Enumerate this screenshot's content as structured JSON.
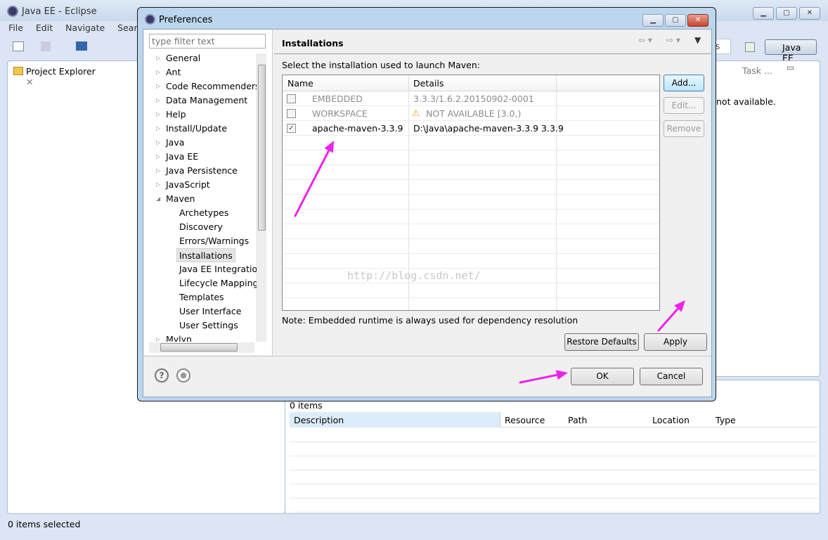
{
  "eclipse": {
    "title": "Java EE - Eclipse",
    "menu": [
      "File",
      "Edit",
      "Navigate",
      "Search"
    ],
    "perspective": "Java EE",
    "project_explorer_tab": "Project Explorer",
    "task_tab": "Task ...",
    "not_available": "not available.",
    "quick_access_partial": "s",
    "status": "0 items selected",
    "markers": {
      "count": "0 items",
      "columns": [
        "Description",
        "Resource",
        "Path",
        "Location",
        "Type"
      ]
    }
  },
  "dialog": {
    "title": "Preferences",
    "filter_placeholder": "type filter text",
    "tree": [
      {
        "label": "General",
        "level": 0,
        "expanded": false
      },
      {
        "label": "Ant",
        "level": 0,
        "expanded": false
      },
      {
        "label": "Code Recommenders",
        "level": 0,
        "expanded": false
      },
      {
        "label": "Data Management",
        "level": 0,
        "expanded": false
      },
      {
        "label": "Help",
        "level": 0,
        "expanded": false
      },
      {
        "label": "Install/Update",
        "level": 0,
        "expanded": false
      },
      {
        "label": "Java",
        "level": 0,
        "expanded": false
      },
      {
        "label": "Java EE",
        "level": 0,
        "expanded": false
      },
      {
        "label": "Java Persistence",
        "level": 0,
        "expanded": false
      },
      {
        "label": "JavaScript",
        "level": 0,
        "expanded": false
      },
      {
        "label": "Maven",
        "level": 0,
        "expanded": true
      },
      {
        "label": "Archetypes",
        "level": 1
      },
      {
        "label": "Discovery",
        "level": 1
      },
      {
        "label": "Errors/Warnings",
        "level": 1
      },
      {
        "label": "Installations",
        "level": 1,
        "selected": true
      },
      {
        "label": "Java EE Integration",
        "level": 1
      },
      {
        "label": "Lifecycle Mapping",
        "level": 1
      },
      {
        "label": "Templates",
        "level": 1
      },
      {
        "label": "User Interface",
        "level": 1
      },
      {
        "label": "User Settings",
        "level": 1
      },
      {
        "label": "Mylyn",
        "level": 0,
        "expanded": false
      }
    ],
    "page_title": "Installations",
    "instruction": "Select the installation used to launch Maven:",
    "columns": [
      "Name",
      "Details"
    ],
    "installations": [
      {
        "name": "EMBEDDED",
        "details": "3.3.3/1.6.2.20150902-0001",
        "checked": false,
        "disabled": true,
        "warning": false
      },
      {
        "name": "WORKSPACE",
        "details": "NOT AVAILABLE [3.0,)",
        "checked": false,
        "disabled": true,
        "warning": true
      },
      {
        "name": "apache-maven-3.3.9",
        "details": "D:\\Java\\apache-maven-3.3.9 3.3.9",
        "checked": true,
        "disabled": false,
        "warning": false
      }
    ],
    "buttons": {
      "add": "Add...",
      "edit": "Edit...",
      "remove": "Remove",
      "restore": "Restore Defaults",
      "apply": "Apply",
      "ok": "OK",
      "cancel": "Cancel"
    },
    "note": "Note: Embedded runtime is always used for dependency resolution",
    "watermark": "http://blog.csdn.net/"
  },
  "colors": {
    "annotation_arrow": "#ee22ee",
    "accent": "#3c7fb1"
  }
}
